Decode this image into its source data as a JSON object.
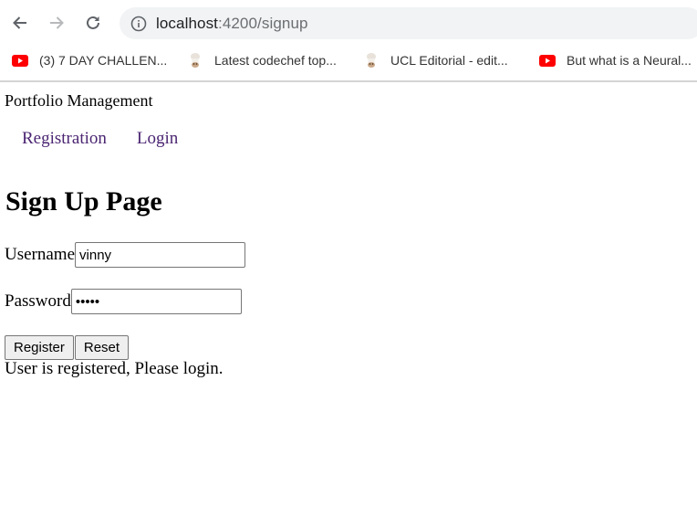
{
  "browser": {
    "url_host": "localhost",
    "url_path": ":4200/signup",
    "bookmarks": [
      {
        "icon": "youtube-icon",
        "label": "(3) 7 DAY CHALLEN..."
      },
      {
        "icon": "codechef-icon",
        "label": "Latest codechef top..."
      },
      {
        "icon": "codechef-icon",
        "label": "UCL Editorial - edit..."
      },
      {
        "icon": "youtube-icon",
        "label": "But what is a Neural..."
      }
    ],
    "colors": {
      "youtube_red": "#ff0000",
      "omnibox_bg": "#f1f3f4"
    }
  },
  "app": {
    "brand": "Portfolio Management",
    "nav": [
      {
        "label": "Registration"
      },
      {
        "label": "Login"
      }
    ],
    "nav_link_color": "#4b2572"
  },
  "form": {
    "title": "Sign Up Page",
    "username_label": "Username",
    "username_value": "vinny",
    "password_label": "Password",
    "password_value": "•••••",
    "register_label": "Register",
    "reset_label": "Reset"
  },
  "status": {
    "message": "User is registered, Please login."
  }
}
